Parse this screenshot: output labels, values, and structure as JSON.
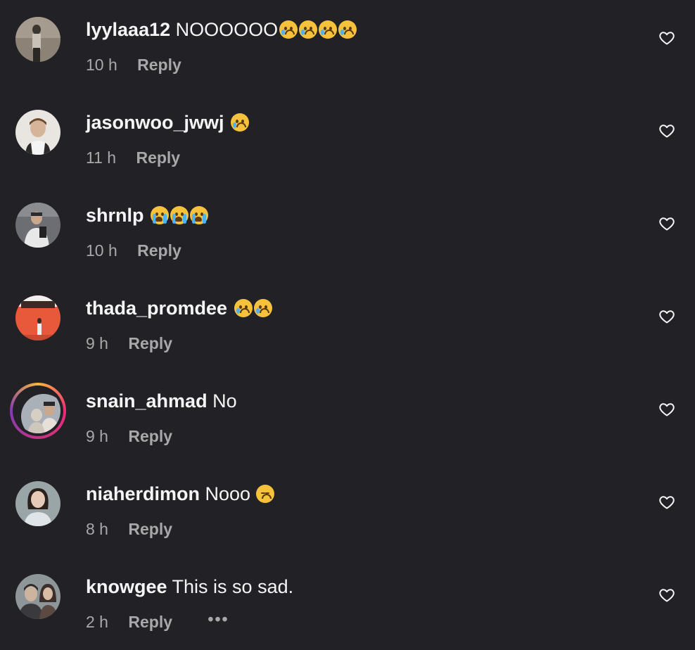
{
  "comments": [
    {
      "username": "lyylaaa12",
      "text": "NOOOOOO",
      "emojis": [
        "cry",
        "cry",
        "cry",
        "cry"
      ],
      "time": "10 h",
      "reply": "Reply",
      "avatar_colors": [
        "#8c8275",
        "#3a3630",
        "#c9c2b8"
      ]
    },
    {
      "username": "jasonwoo_jwwj",
      "text": "",
      "emojis": [
        "cry"
      ],
      "time": "11 h",
      "reply": "Reply",
      "avatar_colors": [
        "#e9e6e2",
        "#6b4a30",
        "#d6b49a"
      ]
    },
    {
      "username": "shrnlp",
      "text": "",
      "emojis": [
        "sob",
        "sob",
        "sob"
      ],
      "time": "10 h",
      "reply": "Reply",
      "avatar_colors": [
        "#6c6e74",
        "#2a2c30",
        "#e8e8e8"
      ]
    },
    {
      "username": "thada_promdee",
      "text": "",
      "emojis": [
        "cry",
        "cry"
      ],
      "time": "9 h",
      "reply": "Reply",
      "avatar_colors": [
        "#e8593c",
        "#3a2a22",
        "#f0f0f0"
      ]
    },
    {
      "username": "snain_ahmad",
      "text": "No",
      "emojis": [],
      "time": "9 h",
      "reply": "Reply",
      "avatar_colors": [
        "#a9b0b8",
        "#2a2a2c",
        "#e6e0d8"
      ]
    },
    {
      "username": "niaherdimon",
      "text": "Nooo",
      "emojis": [
        "dis"
      ],
      "time": "8 h",
      "reply": "Reply",
      "avatar_colors": [
        "#9aa5a8",
        "#2b211c",
        "#e5cbb8"
      ]
    },
    {
      "username": "knowgee",
      "text": "This is so sad.",
      "emojis": [],
      "time": "2 h",
      "reply": "Reply",
      "more": "•••",
      "avatar_colors": [
        "#8f969a",
        "#2c2a2a",
        "#cdb49f"
      ]
    }
  ]
}
